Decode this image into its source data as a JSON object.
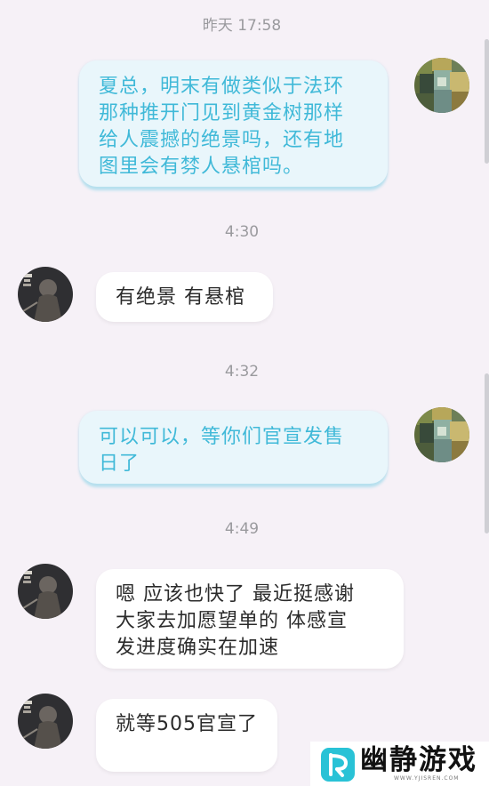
{
  "messages": [
    {
      "time": "昨天 17:58",
      "sender": "me",
      "text": "夏总，明末有做类似于法环\n那种推开门见到黄金树那样\n给人震撼的绝景吗，还有地\n图里会有棼人悬棺吗。"
    },
    {
      "time": "4:30",
      "sender": "other",
      "text": "有绝景  有悬棺"
    },
    {
      "time": "4:32",
      "sender": "me",
      "text": "可以可以，等你们官宣发售\n日了"
    },
    {
      "time": "4:49",
      "sender": "other",
      "text": "嗯 应该也快了  最近挺感谢\n大家去加愿望单的   体感宣\n发进度确实在加速"
    },
    {
      "time": "",
      "sender": "other",
      "text": "就等505官宣了"
    }
  ],
  "watermark": {
    "text": "幽静游戏",
    "url": "WWW.YJISREN.COM"
  },
  "colors": {
    "background": "#f6f1f7",
    "outgoing_bubble": "#e9f6fb",
    "outgoing_text": "#40b9d8",
    "incoming_bubble": "#ffffff",
    "incoming_text": "#2b2b2b",
    "timestamp": "#9a9a9e"
  }
}
